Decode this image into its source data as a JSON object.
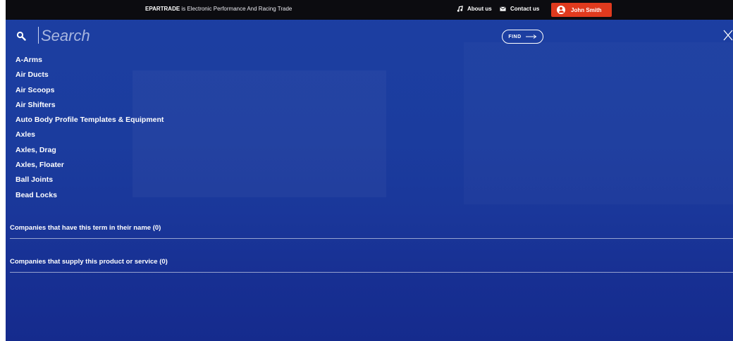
{
  "topbar": {
    "brand": "EPARTRADE",
    "tagline": " is Electronic Performance And Racing Trade",
    "about_label": "About us",
    "contact_label": "Contact us",
    "user_name": "John Smith"
  },
  "search": {
    "placeholder": "Search",
    "value": "",
    "find_label": "FIND"
  },
  "results": [
    "A-Arms",
    "Air Ducts",
    "Air Scoops",
    "Air Shifters",
    "Auto Body Profile Templates & Equipment",
    "Axles",
    "Axles, Drag",
    "Axles, Floater",
    "Ball Joints",
    "Bead Locks"
  ],
  "companies": {
    "name_match_heading": "Companies that have this term in their name (0)",
    "supply_heading": "Companies that supply this product or service (0)"
  },
  "colors": {
    "topbar_bg": "#0c0c10",
    "panel_bg": "#1b3c9e",
    "user_button": "#e03a1e",
    "text": "#ffffff"
  }
}
